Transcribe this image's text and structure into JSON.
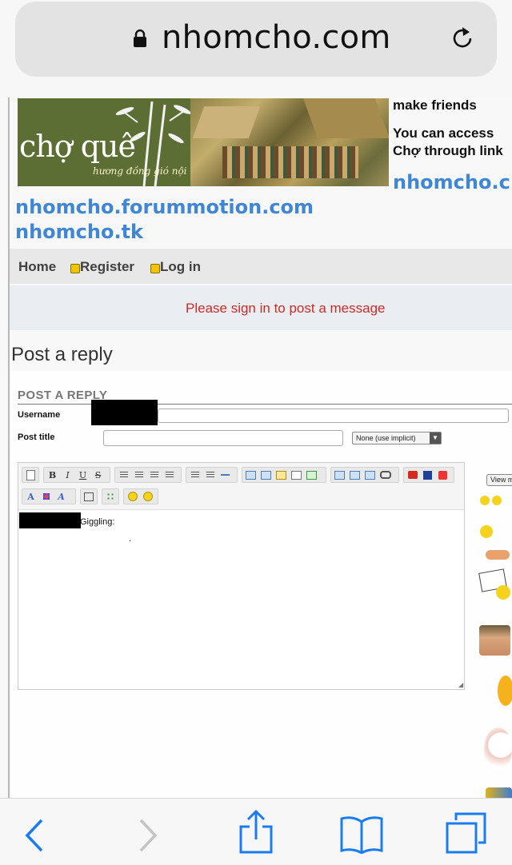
{
  "browser": {
    "url": "nhomcho.com",
    "icons": [
      "lock-icon",
      "reload-icon",
      "back-icon",
      "forward-icon",
      "share-icon",
      "bookmarks-icon",
      "tabs-icon"
    ],
    "accent_color": "#1a7cf0"
  },
  "header": {
    "logo_text": "chợ quê",
    "logo_tagline": "hương đồng gió nội",
    "intro_lines": [
      "make friends",
      "You can access",
      "Chợ through link"
    ],
    "domain_link": "nhomcho.c",
    "alt_links": [
      "nhomcho.forummotion.com",
      "nhomcho.tk"
    ]
  },
  "nav": {
    "home": "Home",
    "register": "Register",
    "login": "Log in"
  },
  "notice": {
    "text": "Please sign in to post a message",
    "color": "#cc2a25"
  },
  "post": {
    "page_title": "Post a reply",
    "section_title": "POST A REPLY",
    "username_label": "Username",
    "post_title_label": "Post title",
    "icon_select_value": "None (use implicit)",
    "message_text": "Giggling:",
    "message_dot": ".",
    "view_more": "View more"
  },
  "colors": {
    "link_blue": "#3f87d6",
    "logo_green": "#5c6e33"
  }
}
